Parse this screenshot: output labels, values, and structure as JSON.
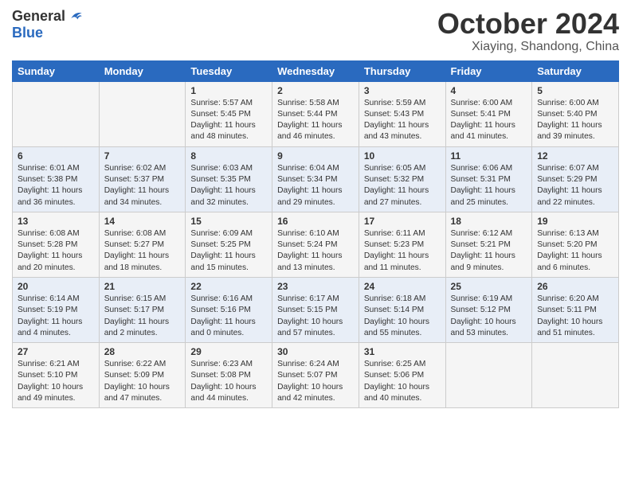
{
  "header": {
    "logo_general": "General",
    "logo_blue": "Blue",
    "title": "October 2024",
    "location": "Xiaying, Shandong, China"
  },
  "days_of_week": [
    "Sunday",
    "Monday",
    "Tuesday",
    "Wednesday",
    "Thursday",
    "Friday",
    "Saturday"
  ],
  "weeks": [
    [
      {
        "day": "",
        "info": ""
      },
      {
        "day": "",
        "info": ""
      },
      {
        "day": "1",
        "info": "Sunrise: 5:57 AM\nSunset: 5:45 PM\nDaylight: 11 hours\nand 48 minutes."
      },
      {
        "day": "2",
        "info": "Sunrise: 5:58 AM\nSunset: 5:44 PM\nDaylight: 11 hours\nand 46 minutes."
      },
      {
        "day": "3",
        "info": "Sunrise: 5:59 AM\nSunset: 5:43 PM\nDaylight: 11 hours\nand 43 minutes."
      },
      {
        "day": "4",
        "info": "Sunrise: 6:00 AM\nSunset: 5:41 PM\nDaylight: 11 hours\nand 41 minutes."
      },
      {
        "day": "5",
        "info": "Sunrise: 6:00 AM\nSunset: 5:40 PM\nDaylight: 11 hours\nand 39 minutes."
      }
    ],
    [
      {
        "day": "6",
        "info": "Sunrise: 6:01 AM\nSunset: 5:38 PM\nDaylight: 11 hours\nand 36 minutes."
      },
      {
        "day": "7",
        "info": "Sunrise: 6:02 AM\nSunset: 5:37 PM\nDaylight: 11 hours\nand 34 minutes."
      },
      {
        "day": "8",
        "info": "Sunrise: 6:03 AM\nSunset: 5:35 PM\nDaylight: 11 hours\nand 32 minutes."
      },
      {
        "day": "9",
        "info": "Sunrise: 6:04 AM\nSunset: 5:34 PM\nDaylight: 11 hours\nand 29 minutes."
      },
      {
        "day": "10",
        "info": "Sunrise: 6:05 AM\nSunset: 5:32 PM\nDaylight: 11 hours\nand 27 minutes."
      },
      {
        "day": "11",
        "info": "Sunrise: 6:06 AM\nSunset: 5:31 PM\nDaylight: 11 hours\nand 25 minutes."
      },
      {
        "day": "12",
        "info": "Sunrise: 6:07 AM\nSunset: 5:29 PM\nDaylight: 11 hours\nand 22 minutes."
      }
    ],
    [
      {
        "day": "13",
        "info": "Sunrise: 6:08 AM\nSunset: 5:28 PM\nDaylight: 11 hours\nand 20 minutes."
      },
      {
        "day": "14",
        "info": "Sunrise: 6:08 AM\nSunset: 5:27 PM\nDaylight: 11 hours\nand 18 minutes."
      },
      {
        "day": "15",
        "info": "Sunrise: 6:09 AM\nSunset: 5:25 PM\nDaylight: 11 hours\nand 15 minutes."
      },
      {
        "day": "16",
        "info": "Sunrise: 6:10 AM\nSunset: 5:24 PM\nDaylight: 11 hours\nand 13 minutes."
      },
      {
        "day": "17",
        "info": "Sunrise: 6:11 AM\nSunset: 5:23 PM\nDaylight: 11 hours\nand 11 minutes."
      },
      {
        "day": "18",
        "info": "Sunrise: 6:12 AM\nSunset: 5:21 PM\nDaylight: 11 hours\nand 9 minutes."
      },
      {
        "day": "19",
        "info": "Sunrise: 6:13 AM\nSunset: 5:20 PM\nDaylight: 11 hours\nand 6 minutes."
      }
    ],
    [
      {
        "day": "20",
        "info": "Sunrise: 6:14 AM\nSunset: 5:19 PM\nDaylight: 11 hours\nand 4 minutes."
      },
      {
        "day": "21",
        "info": "Sunrise: 6:15 AM\nSunset: 5:17 PM\nDaylight: 11 hours\nand 2 minutes."
      },
      {
        "day": "22",
        "info": "Sunrise: 6:16 AM\nSunset: 5:16 PM\nDaylight: 11 hours\nand 0 minutes."
      },
      {
        "day": "23",
        "info": "Sunrise: 6:17 AM\nSunset: 5:15 PM\nDaylight: 10 hours\nand 57 minutes."
      },
      {
        "day": "24",
        "info": "Sunrise: 6:18 AM\nSunset: 5:14 PM\nDaylight: 10 hours\nand 55 minutes."
      },
      {
        "day": "25",
        "info": "Sunrise: 6:19 AM\nSunset: 5:12 PM\nDaylight: 10 hours\nand 53 minutes."
      },
      {
        "day": "26",
        "info": "Sunrise: 6:20 AM\nSunset: 5:11 PM\nDaylight: 10 hours\nand 51 minutes."
      }
    ],
    [
      {
        "day": "27",
        "info": "Sunrise: 6:21 AM\nSunset: 5:10 PM\nDaylight: 10 hours\nand 49 minutes."
      },
      {
        "day": "28",
        "info": "Sunrise: 6:22 AM\nSunset: 5:09 PM\nDaylight: 10 hours\nand 47 minutes."
      },
      {
        "day": "29",
        "info": "Sunrise: 6:23 AM\nSunset: 5:08 PM\nDaylight: 10 hours\nand 44 minutes."
      },
      {
        "day": "30",
        "info": "Sunrise: 6:24 AM\nSunset: 5:07 PM\nDaylight: 10 hours\nand 42 minutes."
      },
      {
        "day": "31",
        "info": "Sunrise: 6:25 AM\nSunset: 5:06 PM\nDaylight: 10 hours\nand 40 minutes."
      },
      {
        "day": "",
        "info": ""
      },
      {
        "day": "",
        "info": ""
      }
    ]
  ]
}
